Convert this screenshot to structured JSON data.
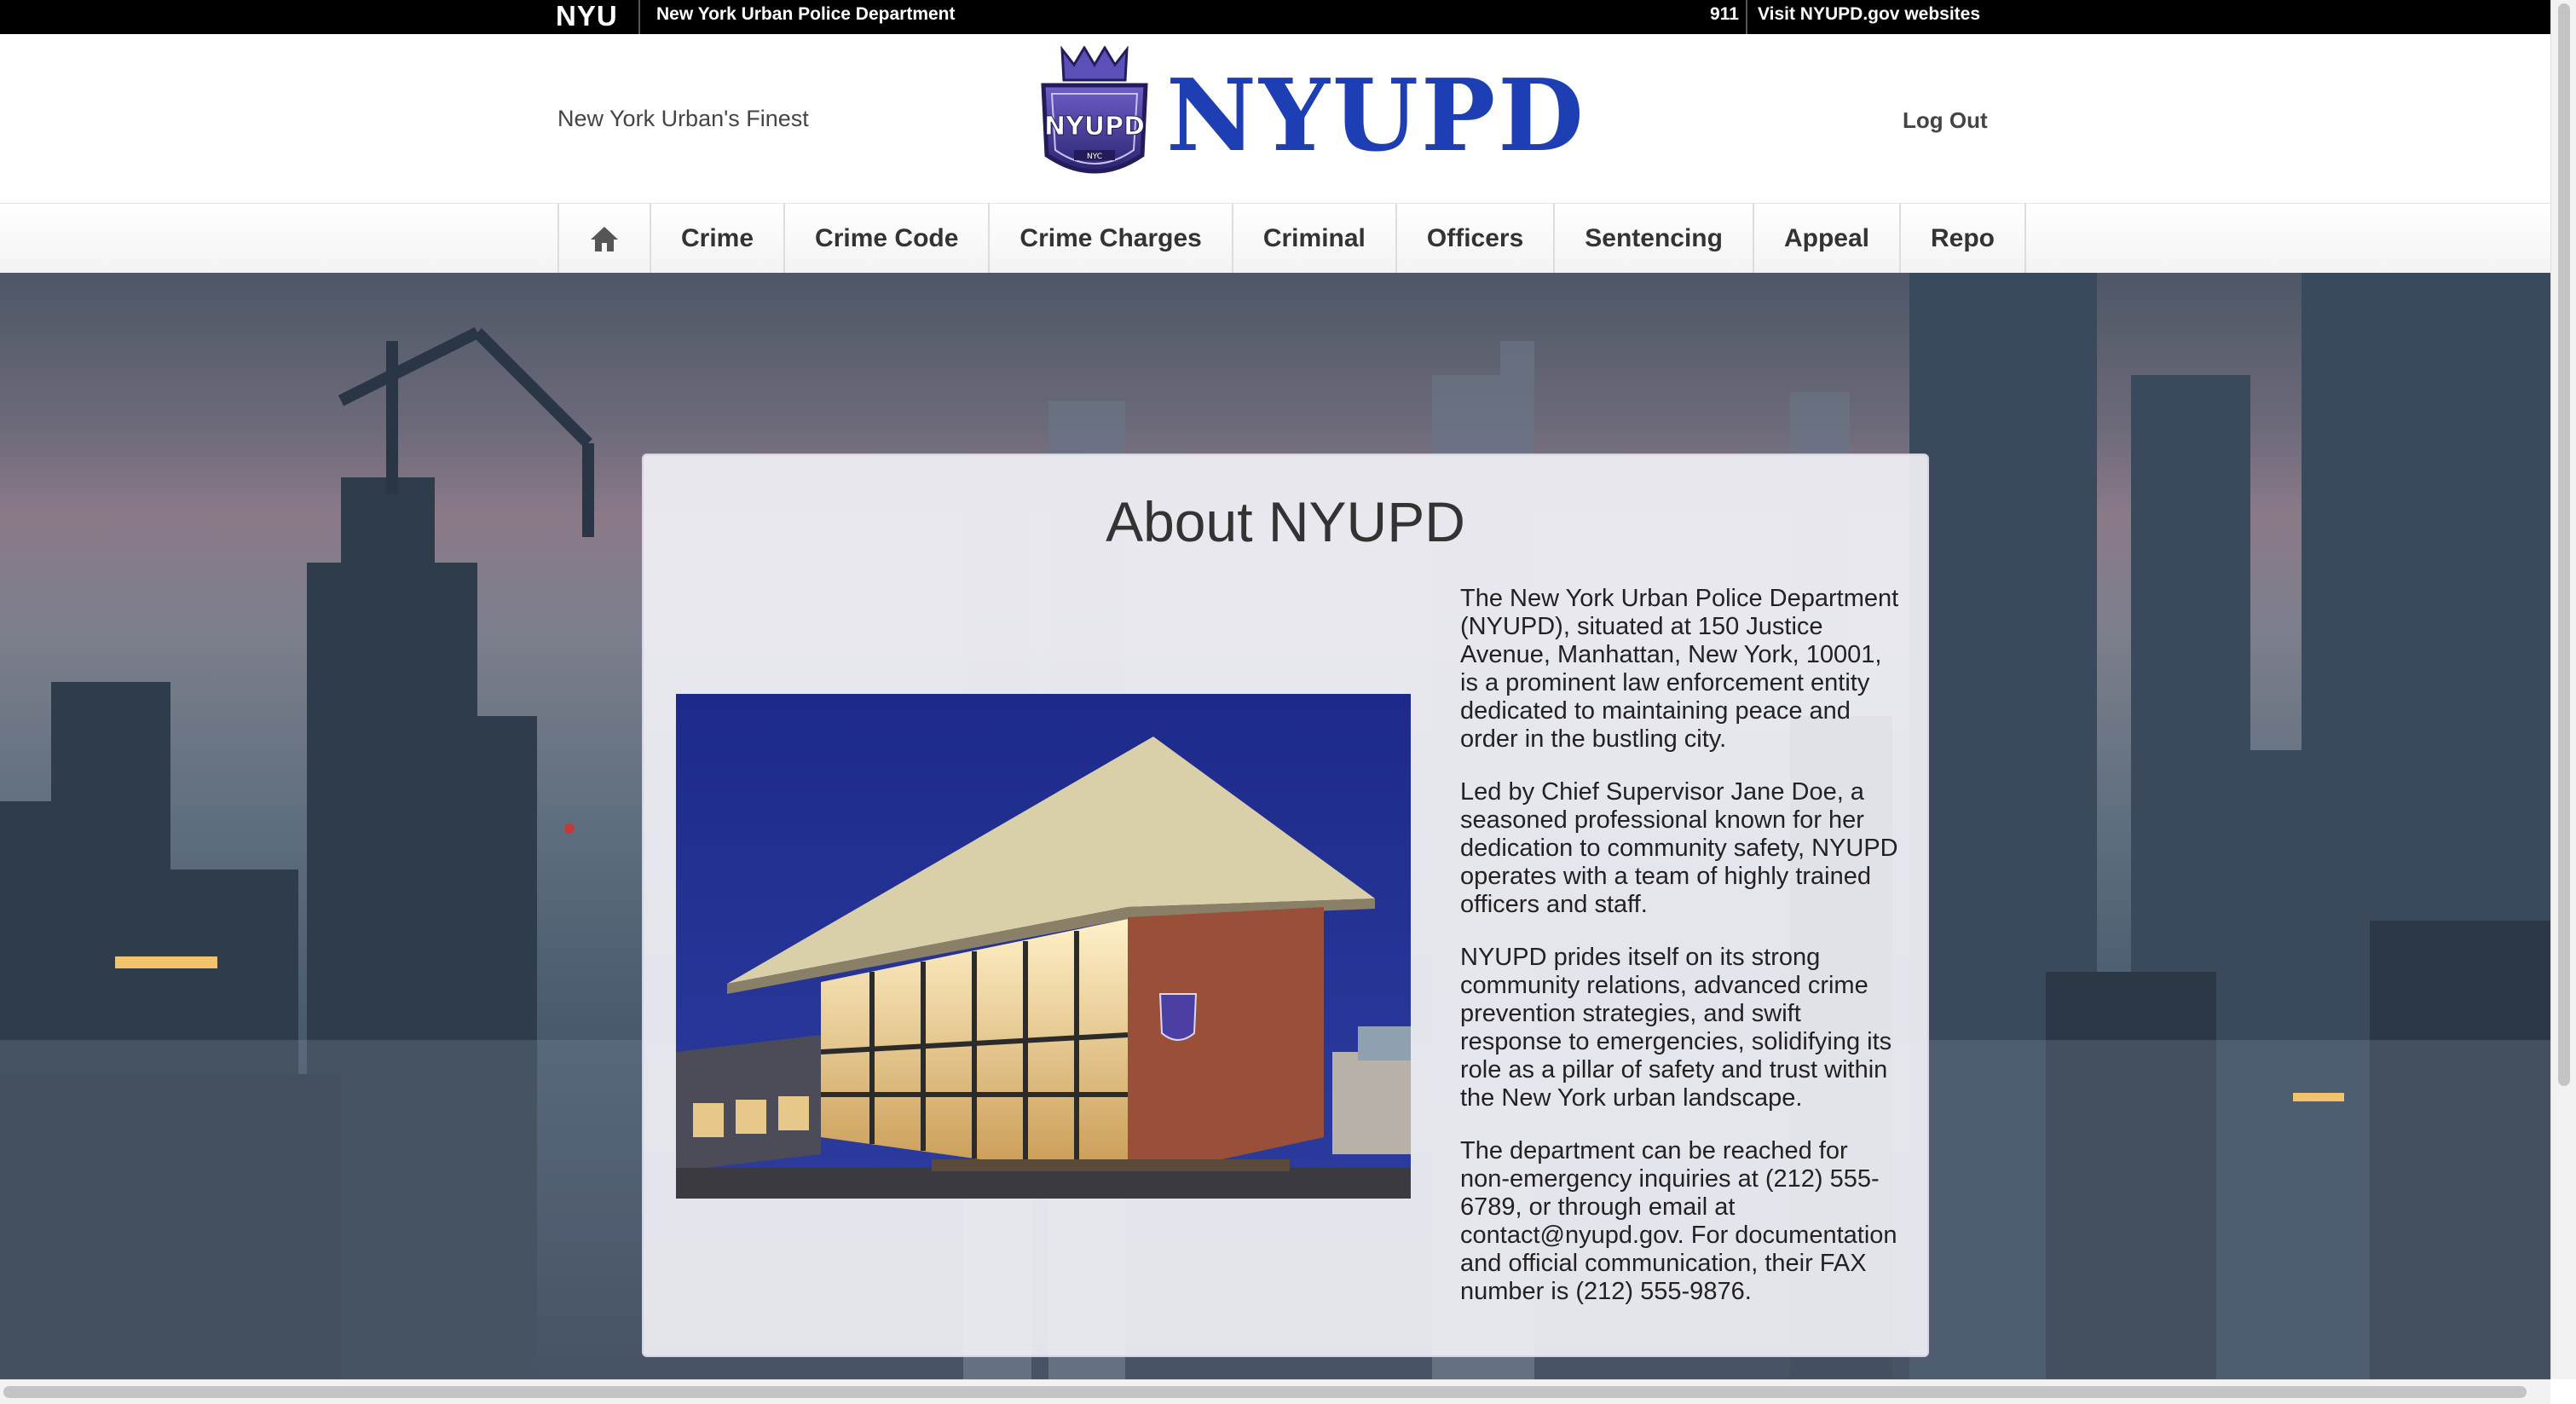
{
  "topbar": {
    "brand": "NYU",
    "department": "New York Urban Police Department",
    "emergency": "911",
    "visit_link": "Visit NYUPD.gov websites"
  },
  "header": {
    "tagline": "New York Urban's Finest",
    "logo_text": "NYUPD",
    "logout_label": "Log Out",
    "brand_color": "#1d3fb3"
  },
  "nav": {
    "home_icon": "home-icon",
    "items": [
      "Crime",
      "Crime Code",
      "Crime Charges",
      "Criminal",
      "Officers",
      "Sentencing",
      "Appeal",
      "Repo"
    ]
  },
  "about": {
    "title": "About NYUPD",
    "paragraphs": [
      "The New York Urban Police Department (NYUPD), situated at 150 Justice Avenue, Manhattan, New York, 10001, is a prominent law enforcement entity dedicated to maintaining peace and order in the bustling city.",
      "Led by Chief Supervisor Jane Doe, a seasoned professional known for her dedication to community safety, NYUPD operates with a team of highly trained officers and staff.",
      "NYUPD prides itself on its strong community relations, advanced crime prevention strategies, and swift response to emergencies, solidifying its role as a pillar of safety and trust within the New York urban landscape.",
      "The department can be reached for non-emergency inquiries at (212) 555-6789, or through email at contact@nyupd.gov. For documentation and official communication, their FAX number is (212) 555-9876."
    ]
  }
}
